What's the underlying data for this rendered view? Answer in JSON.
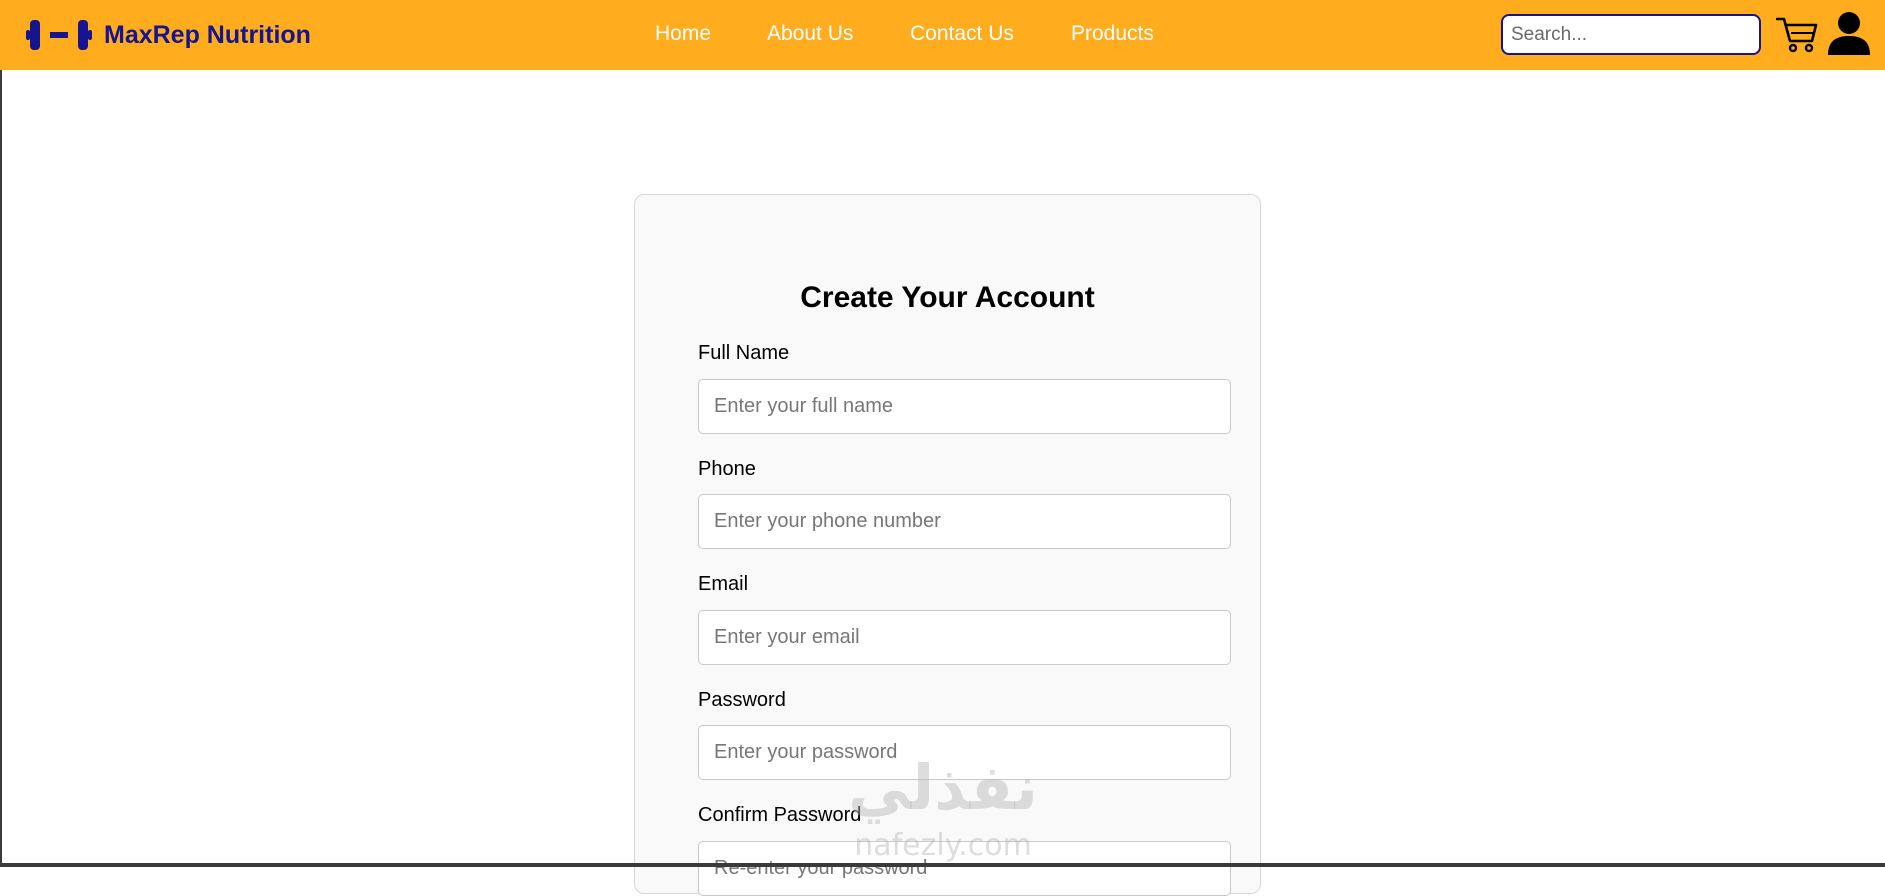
{
  "brand": {
    "name": "MaxRep Nutrition",
    "color": "#16148f",
    "icon": "dumbbell-icon"
  },
  "nav": {
    "background": "#ffad1f",
    "links": [
      "Home",
      "About Us",
      "Contact Us",
      "Products"
    ]
  },
  "search": {
    "placeholder": "Search...",
    "value": ""
  },
  "icons": {
    "cart": "cart-icon",
    "user": "user-icon"
  },
  "form": {
    "title": "Create Your Account",
    "fields": [
      {
        "label": "Full Name",
        "placeholder": "Enter your full name",
        "value": ""
      },
      {
        "label": "Phone",
        "placeholder": "Enter your phone number",
        "value": ""
      },
      {
        "label": "Email",
        "placeholder": "Enter your email",
        "value": ""
      },
      {
        "label": "Password",
        "placeholder": "Enter your password",
        "value": ""
      },
      {
        "label": "Confirm Password",
        "placeholder": "Re-enter your password",
        "value": ""
      }
    ]
  },
  "watermark": {
    "arabic": "نفذلي",
    "latin": "nafezly.com"
  }
}
